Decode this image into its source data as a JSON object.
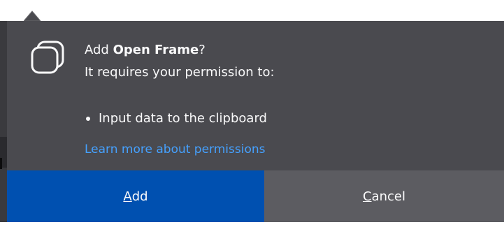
{
  "dialog": {
    "title_prefix": "Add ",
    "extension_name": "Open Frame",
    "title_suffix": "?",
    "subtitle": "It requires your permission to:",
    "permissions": [
      "Input data to the clipboard"
    ],
    "learn_more_label": "Learn more about permissions",
    "icon": "extension-icon"
  },
  "buttons": {
    "add": {
      "mnemonic": "A",
      "rest": "dd"
    },
    "cancel": {
      "mnemonic": "C",
      "rest": "ancel"
    }
  },
  "colors": {
    "panel_bg": "#4a4a4f",
    "text": "#f9f9fa",
    "link": "#45a1ff",
    "primary_button": "#0050b0",
    "secondary_button": "#5c5c61"
  }
}
